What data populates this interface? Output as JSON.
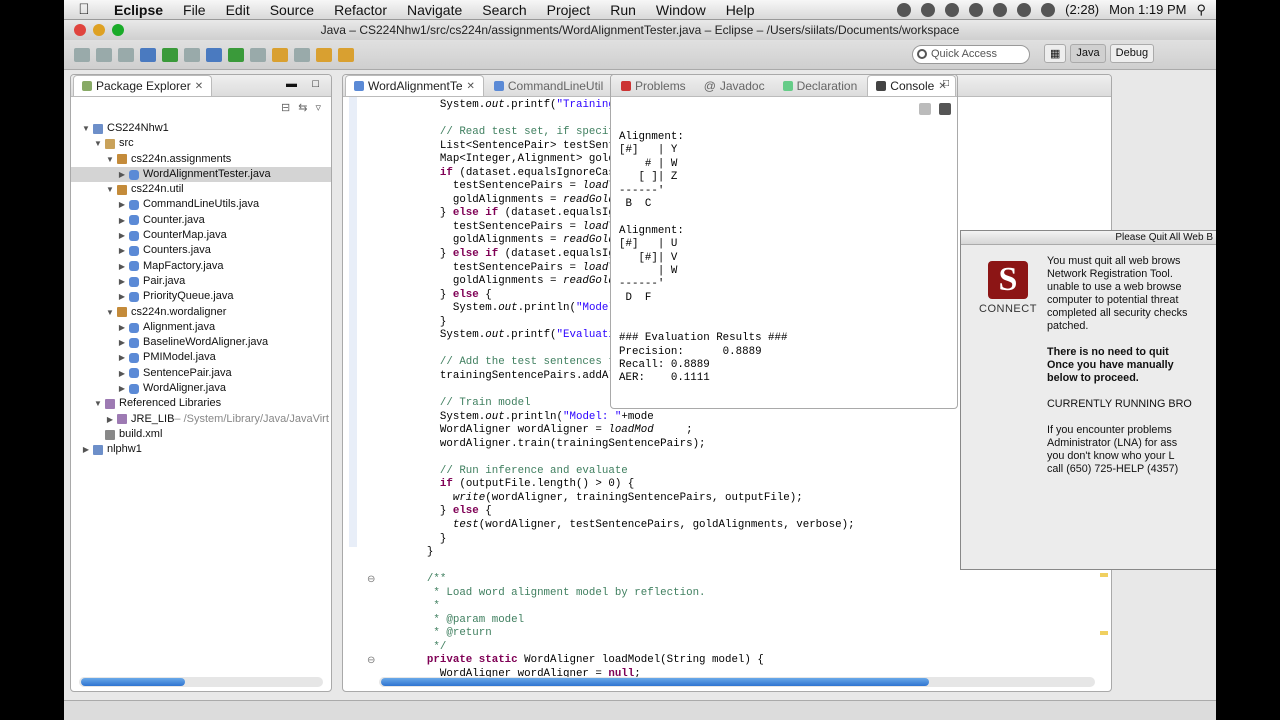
{
  "menubar": {
    "app": "Eclipse",
    "items": [
      "File",
      "Edit",
      "Source",
      "Refactor",
      "Navigate",
      "Search",
      "Project",
      "Run",
      "Window",
      "Help"
    ],
    "battery": "(2:28)",
    "clock": "Mon 1:19 PM"
  },
  "window": {
    "title": "Java – CS224Nhw1/src/cs224n/assignments/WordAlignmentTester.java – Eclipse – /Users/siilats/Documents/workspace"
  },
  "toolbar": {
    "quick_access_placeholder": "Quick Access",
    "perspectives": [
      "Java",
      "Debug"
    ]
  },
  "explorer": {
    "tab_label": "Package Explorer",
    "tree": [
      {
        "label": "CS224Nhw1",
        "level": 0,
        "arrow": "open",
        "icon": "project"
      },
      {
        "label": "src",
        "level": 1,
        "arrow": "open",
        "icon": "src"
      },
      {
        "label": "cs224n.assignments",
        "level": 2,
        "arrow": "open",
        "icon": "package"
      },
      {
        "label": "WordAlignmentTester.java",
        "level": 3,
        "arrow": "closed",
        "icon": "java",
        "selected": true
      },
      {
        "label": "cs224n.util",
        "level": 2,
        "arrow": "open",
        "icon": "package"
      },
      {
        "label": "CommandLineUtils.java",
        "level": 3,
        "arrow": "closed",
        "icon": "java"
      },
      {
        "label": "Counter.java",
        "level": 3,
        "arrow": "closed",
        "icon": "java"
      },
      {
        "label": "CounterMap.java",
        "level": 3,
        "arrow": "closed",
        "icon": "java"
      },
      {
        "label": "Counters.java",
        "level": 3,
        "arrow": "closed",
        "icon": "java"
      },
      {
        "label": "MapFactory.java",
        "level": 3,
        "arrow": "closed",
        "icon": "java"
      },
      {
        "label": "Pair.java",
        "level": 3,
        "arrow": "closed",
        "icon": "java"
      },
      {
        "label": "PriorityQueue.java",
        "level": 3,
        "arrow": "closed",
        "icon": "java"
      },
      {
        "label": "cs224n.wordaligner",
        "level": 2,
        "arrow": "open",
        "icon": "package"
      },
      {
        "label": "Alignment.java",
        "level": 3,
        "arrow": "closed",
        "icon": "java"
      },
      {
        "label": "BaselineWordAligner.java",
        "level": 3,
        "arrow": "closed",
        "icon": "java"
      },
      {
        "label": "PMIModel.java",
        "level": 3,
        "arrow": "closed",
        "icon": "java"
      },
      {
        "label": "SentencePair.java",
        "level": 3,
        "arrow": "closed",
        "icon": "java"
      },
      {
        "label": "WordAligner.java",
        "level": 3,
        "arrow": "closed",
        "icon": "java"
      },
      {
        "label": "Referenced Libraries",
        "level": 1,
        "arrow": "open",
        "icon": "library"
      },
      {
        "label": "JRE_LIB",
        "suffix": " – /System/Library/Java/JavaVirt",
        "level": 2,
        "arrow": "closed",
        "icon": "library"
      },
      {
        "label": "build.xml",
        "level": 1,
        "arrow": "none",
        "icon": "xml"
      },
      {
        "label": "nlphw1",
        "level": 0,
        "arrow": "closed",
        "icon": "project"
      }
    ]
  },
  "editor": {
    "tabs": [
      {
        "label": "WordAlignmentTe",
        "active": true
      },
      {
        "label": "CommandLineUtil",
        "active": false
      }
    ],
    "lines": [
      [
        [
          "",
          "      System."
        ],
        [
          "it",
          "out"
        ],
        [
          "",
          ".printf("
        ],
        [
          "str",
          "\"Training set :"
        ]
      ],
      [
        [
          "",
          ""
        ]
      ],
      [
        [
          "",
          "      "
        ],
        [
          "cm",
          "// Read test set, if specified."
        ]
      ],
      [
        [
          "",
          "      List<SentencePair> testSentenceP"
        ]
      ],
      [
        [
          "",
          "      Map<Integer,Alignment> goldAlignm"
        ]
      ],
      [
        [
          "",
          "      "
        ],
        [
          "kw",
          "if"
        ],
        [
          "",
          " (dataset.equalsIgnoreCase("
        ],
        [
          "str",
          "\"te"
        ]
      ],
      [
        [
          "",
          "        testSentencePairs = "
        ],
        [
          "it",
          "loadTestDa"
        ]
      ],
      [
        [
          "",
          "        goldAlignments = "
        ],
        [
          "it",
          "readGoldAlign"
        ]
      ],
      [
        [
          "",
          "      } "
        ],
        [
          "kw",
          "else if"
        ],
        [
          "",
          " (dataset.equalsIgnoreC"
        ]
      ],
      [
        [
          "",
          "        testSentencePairs = "
        ],
        [
          "it",
          "loadTestDa"
        ]
      ],
      [
        [
          "",
          "        goldAlignments = "
        ],
        [
          "it",
          "readGoldAlign"
        ]
      ],
      [
        [
          "",
          "      } "
        ],
        [
          "kw",
          "else if"
        ],
        [
          "",
          " (dataset.equalsIgnoreC"
        ]
      ],
      [
        [
          "",
          "        testSentencePairs = "
        ],
        [
          "it",
          "loadTestDa"
        ]
      ],
      [
        [
          "",
          "        goldAlignments = "
        ],
        [
          "it",
          "readGoldAlign"
        ]
      ],
      [
        [
          "",
          "      } "
        ],
        [
          "kw",
          "else"
        ],
        [
          "",
          " {"
        ]
      ],
      [
        [
          "",
          "        System."
        ],
        [
          "it",
          "out"
        ],
        [
          "",
          ".println("
        ],
        [
          "str",
          "\"Model lear"
        ]
      ],
      [
        [
          "",
          "      }"
        ]
      ],
      [
        [
          "",
          "      System."
        ],
        [
          "it",
          "out"
        ],
        [
          "",
          ".printf("
        ],
        [
          "str",
          "\"Evaluation se"
        ]
      ],
      [
        [
          "",
          ""
        ]
      ],
      [
        [
          "",
          "      "
        ],
        [
          "cm",
          "// Add the test sentences to the"
        ]
      ],
      [
        [
          "",
          "      trainingSentencePairs.addAll(tes"
        ]
      ],
      [
        [
          "",
          ""
        ]
      ],
      [
        [
          "",
          "      "
        ],
        [
          "cm",
          "// Train model"
        ]
      ],
      [
        [
          "",
          "      System."
        ],
        [
          "it",
          "out"
        ],
        [
          "",
          ".println("
        ],
        [
          "str",
          "\"Model: \""
        ],
        [
          "",
          "+mode"
        ]
      ],
      [
        [
          "",
          "      WordAligner wordAligner = "
        ],
        [
          "it",
          "loadMod"
        ],
        [
          "",
          "     ;"
        ]
      ],
      [
        [
          "",
          "      wordAligner.train(trainingSentencePairs);"
        ]
      ],
      [
        [
          "",
          ""
        ]
      ],
      [
        [
          "",
          "      "
        ],
        [
          "cm",
          "// Run inference and evaluate"
        ]
      ],
      [
        [
          "",
          "      "
        ],
        [
          "kw",
          "if"
        ],
        [
          "",
          " (outputFile.length() > 0) {"
        ]
      ],
      [
        [
          "",
          "        "
        ],
        [
          "it",
          "write"
        ],
        [
          "",
          "(wordAligner, trainingSentencePairs, outputFile);"
        ]
      ],
      [
        [
          "",
          "      } "
        ],
        [
          "kw",
          "else"
        ],
        [
          "",
          " {"
        ]
      ],
      [
        [
          "",
          "        "
        ],
        [
          "it",
          "test"
        ],
        [
          "",
          "(wordAligner, testSentencePairs, goldAlignments, verbose);"
        ]
      ],
      [
        [
          "",
          "      }"
        ]
      ],
      [
        [
          "",
          "    }"
        ]
      ],
      [
        [
          "",
          ""
        ]
      ],
      [
        [
          "",
          "    "
        ],
        [
          "cm",
          "/**"
        ]
      ],
      [
        [
          "cm",
          "     * Load word alignment model by reflection."
        ]
      ],
      [
        [
          "cm",
          "     *"
        ]
      ],
      [
        [
          "cm",
          "     * @param model"
        ]
      ],
      [
        [
          "cm",
          "     * @return"
        ]
      ],
      [
        [
          "cm",
          "     */"
        ]
      ],
      [
        [
          "",
          "    "
        ],
        [
          "kw",
          "private static"
        ],
        [
          "",
          " WordAligner loadModel(String model) {"
        ]
      ],
      [
        [
          "",
          "      WordAligner wordAligner = "
        ],
        [
          "kw",
          "null"
        ],
        [
          "",
          ";"
        ]
      ]
    ]
  },
  "console": {
    "tabs": [
      {
        "label": "Problems",
        "icon": "problems-icon"
      },
      {
        "label": "Javadoc",
        "icon": "javadoc-icon"
      },
      {
        "label": "Declaration",
        "icon": "declaration-icon"
      },
      {
        "label": "Console",
        "icon": "console-icon",
        "active": true
      }
    ],
    "output": "Alignment:\n[#]   | Y\n    # | W\n   [ ]| Z\n------'\n B  C\n\nAlignment:\n[#]   | U\n   [#]| V\n      | W\n------'\n D  F\n\n\n### Evaluation Results ###\nPrecision:      0.8889\nRecall: 0.8889\nAER:    0.1111"
  },
  "connect": {
    "title": "Please Quit All Web B",
    "logo_letter": "S",
    "logo_word": "CONNECT",
    "p1": [
      "You must quit all web brows",
      "Network Registration Tool.",
      "unable to use a web browse",
      "computer to potential threat",
      "completed all security checks",
      "patched."
    ],
    "p2": [
      "There is no need to quit",
      "Once you have manually",
      "below to proceed."
    ],
    "p3": "CURRENTLY RUNNING BRO",
    "p4": [
      "If you encounter problems",
      "Administrator (LNA) for ass",
      "you don't know who your L",
      "call (650) 725-HELP (4357)"
    ]
  },
  "colors": {
    "keyword": "#7f0055",
    "string": "#2a00ff",
    "comment": "#3f7f5f",
    "stanford_red": "#8c1515",
    "scroll_blue": "#2f74d0"
  }
}
